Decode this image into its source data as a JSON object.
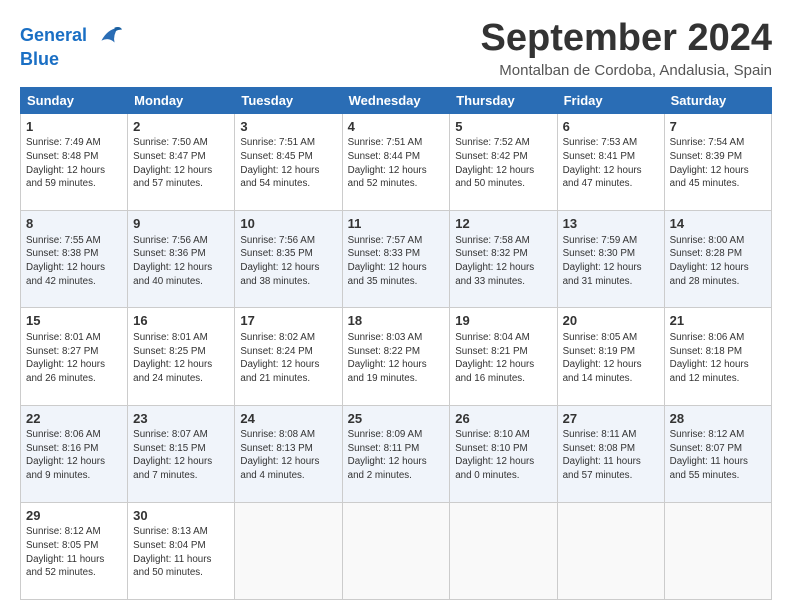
{
  "header": {
    "logo_line1": "General",
    "logo_line2": "Blue",
    "month": "September 2024",
    "location": "Montalban de Cordoba, Andalusia, Spain"
  },
  "weekdays": [
    "Sunday",
    "Monday",
    "Tuesday",
    "Wednesday",
    "Thursday",
    "Friday",
    "Saturday"
  ],
  "weeks": [
    [
      {
        "day": "1",
        "info": "Sunrise: 7:49 AM\nSunset: 8:48 PM\nDaylight: 12 hours\nand 59 minutes."
      },
      {
        "day": "2",
        "info": "Sunrise: 7:50 AM\nSunset: 8:47 PM\nDaylight: 12 hours\nand 57 minutes."
      },
      {
        "day": "3",
        "info": "Sunrise: 7:51 AM\nSunset: 8:45 PM\nDaylight: 12 hours\nand 54 minutes."
      },
      {
        "day": "4",
        "info": "Sunrise: 7:51 AM\nSunset: 8:44 PM\nDaylight: 12 hours\nand 52 minutes."
      },
      {
        "day": "5",
        "info": "Sunrise: 7:52 AM\nSunset: 8:42 PM\nDaylight: 12 hours\nand 50 minutes."
      },
      {
        "day": "6",
        "info": "Sunrise: 7:53 AM\nSunset: 8:41 PM\nDaylight: 12 hours\nand 47 minutes."
      },
      {
        "day": "7",
        "info": "Sunrise: 7:54 AM\nSunset: 8:39 PM\nDaylight: 12 hours\nand 45 minutes."
      }
    ],
    [
      {
        "day": "8",
        "info": "Sunrise: 7:55 AM\nSunset: 8:38 PM\nDaylight: 12 hours\nand 42 minutes."
      },
      {
        "day": "9",
        "info": "Sunrise: 7:56 AM\nSunset: 8:36 PM\nDaylight: 12 hours\nand 40 minutes."
      },
      {
        "day": "10",
        "info": "Sunrise: 7:56 AM\nSunset: 8:35 PM\nDaylight: 12 hours\nand 38 minutes."
      },
      {
        "day": "11",
        "info": "Sunrise: 7:57 AM\nSunset: 8:33 PM\nDaylight: 12 hours\nand 35 minutes."
      },
      {
        "day": "12",
        "info": "Sunrise: 7:58 AM\nSunset: 8:32 PM\nDaylight: 12 hours\nand 33 minutes."
      },
      {
        "day": "13",
        "info": "Sunrise: 7:59 AM\nSunset: 8:30 PM\nDaylight: 12 hours\nand 31 minutes."
      },
      {
        "day": "14",
        "info": "Sunrise: 8:00 AM\nSunset: 8:28 PM\nDaylight: 12 hours\nand 28 minutes."
      }
    ],
    [
      {
        "day": "15",
        "info": "Sunrise: 8:01 AM\nSunset: 8:27 PM\nDaylight: 12 hours\nand 26 minutes."
      },
      {
        "day": "16",
        "info": "Sunrise: 8:01 AM\nSunset: 8:25 PM\nDaylight: 12 hours\nand 24 minutes."
      },
      {
        "day": "17",
        "info": "Sunrise: 8:02 AM\nSunset: 8:24 PM\nDaylight: 12 hours\nand 21 minutes."
      },
      {
        "day": "18",
        "info": "Sunrise: 8:03 AM\nSunset: 8:22 PM\nDaylight: 12 hours\nand 19 minutes."
      },
      {
        "day": "19",
        "info": "Sunrise: 8:04 AM\nSunset: 8:21 PM\nDaylight: 12 hours\nand 16 minutes."
      },
      {
        "day": "20",
        "info": "Sunrise: 8:05 AM\nSunset: 8:19 PM\nDaylight: 12 hours\nand 14 minutes."
      },
      {
        "day": "21",
        "info": "Sunrise: 8:06 AM\nSunset: 8:18 PM\nDaylight: 12 hours\nand 12 minutes."
      }
    ],
    [
      {
        "day": "22",
        "info": "Sunrise: 8:06 AM\nSunset: 8:16 PM\nDaylight: 12 hours\nand 9 minutes."
      },
      {
        "day": "23",
        "info": "Sunrise: 8:07 AM\nSunset: 8:15 PM\nDaylight: 12 hours\nand 7 minutes."
      },
      {
        "day": "24",
        "info": "Sunrise: 8:08 AM\nSunset: 8:13 PM\nDaylight: 12 hours\nand 4 minutes."
      },
      {
        "day": "25",
        "info": "Sunrise: 8:09 AM\nSunset: 8:11 PM\nDaylight: 12 hours\nand 2 minutes."
      },
      {
        "day": "26",
        "info": "Sunrise: 8:10 AM\nSunset: 8:10 PM\nDaylight: 12 hours\nand 0 minutes."
      },
      {
        "day": "27",
        "info": "Sunrise: 8:11 AM\nSunset: 8:08 PM\nDaylight: 11 hours\nand 57 minutes."
      },
      {
        "day": "28",
        "info": "Sunrise: 8:12 AM\nSunset: 8:07 PM\nDaylight: 11 hours\nand 55 minutes."
      }
    ],
    [
      {
        "day": "29",
        "info": "Sunrise: 8:12 AM\nSunset: 8:05 PM\nDaylight: 11 hours\nand 52 minutes."
      },
      {
        "day": "30",
        "info": "Sunrise: 8:13 AM\nSunset: 8:04 PM\nDaylight: 11 hours\nand 50 minutes."
      },
      null,
      null,
      null,
      null,
      null
    ]
  ]
}
